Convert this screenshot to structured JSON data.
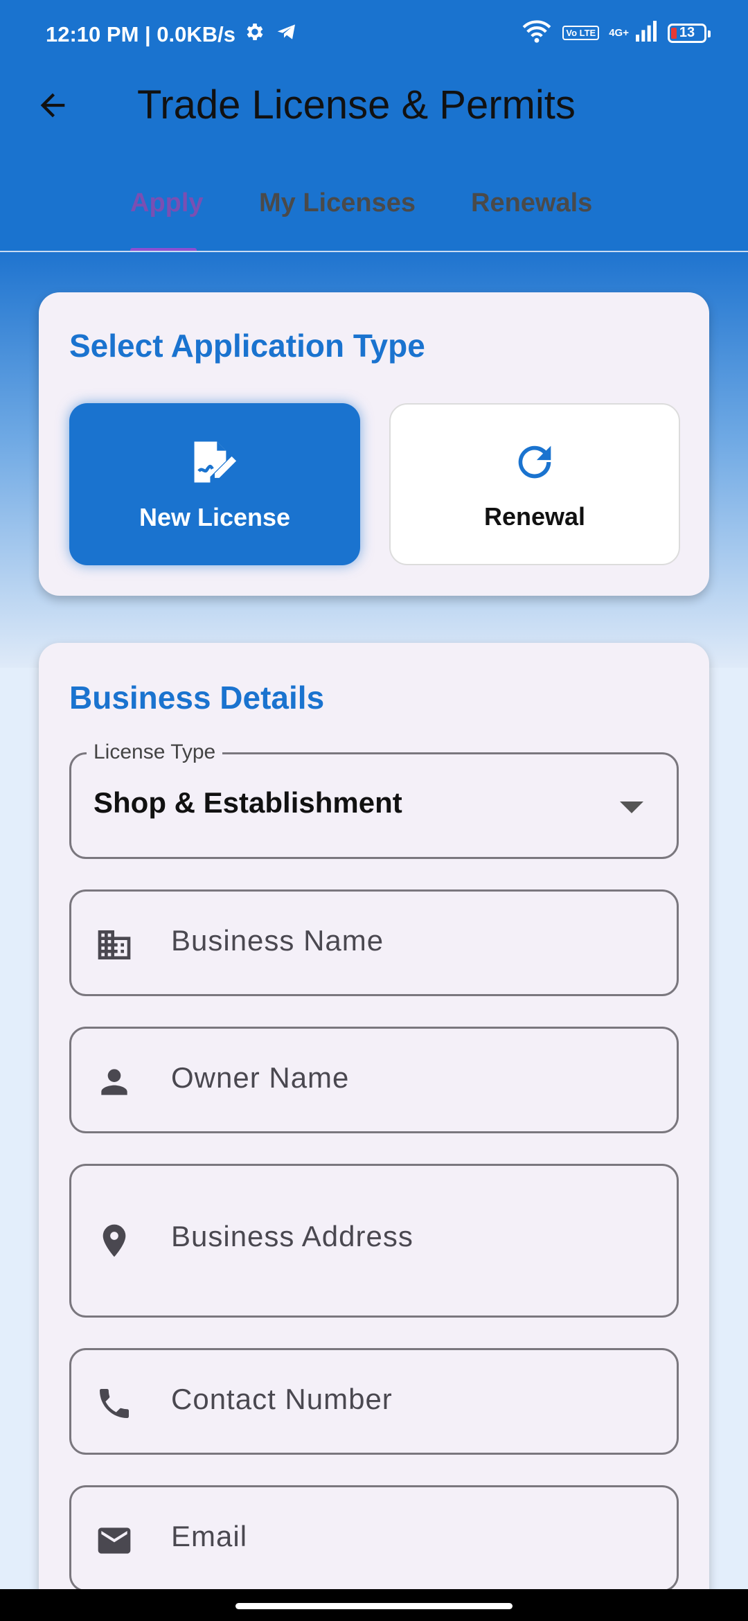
{
  "status_bar": {
    "time_speed": "12:10 PM | 0.0KB/s",
    "network_label": "4G+",
    "volte_label": "Vo LTE",
    "battery": "13"
  },
  "header": {
    "title": "Trade License & Permits",
    "back_icon": "arrow-back-icon"
  },
  "tabs": [
    {
      "label": "Apply",
      "active": true
    },
    {
      "label": "My Licenses",
      "active": false
    },
    {
      "label": "Renewals",
      "active": false
    }
  ],
  "application_type": {
    "title": "Select Application Type",
    "options": [
      {
        "label": "New License",
        "icon": "edit-document-icon",
        "selected": true
      },
      {
        "label": "Renewal",
        "icon": "refresh-icon",
        "selected": false
      }
    ]
  },
  "business_details": {
    "title": "Business Details",
    "license_type": {
      "label": "License Type",
      "value": "Shop & Establishment"
    },
    "fields": {
      "business_name": {
        "placeholder": "Business Name",
        "icon": "business-icon"
      },
      "owner_name": {
        "placeholder": "Owner Name",
        "icon": "person-icon"
      },
      "business_address": {
        "placeholder": "Business Address",
        "icon": "location-pin-icon"
      },
      "contact_number": {
        "placeholder": "Contact Number",
        "icon": "phone-icon"
      },
      "email": {
        "placeholder": "Email",
        "icon": "email-icon"
      }
    }
  },
  "colors": {
    "primary": "#1a73cf",
    "tab_active": "#7a4fb3",
    "card_bg": "#f4f0f8"
  }
}
